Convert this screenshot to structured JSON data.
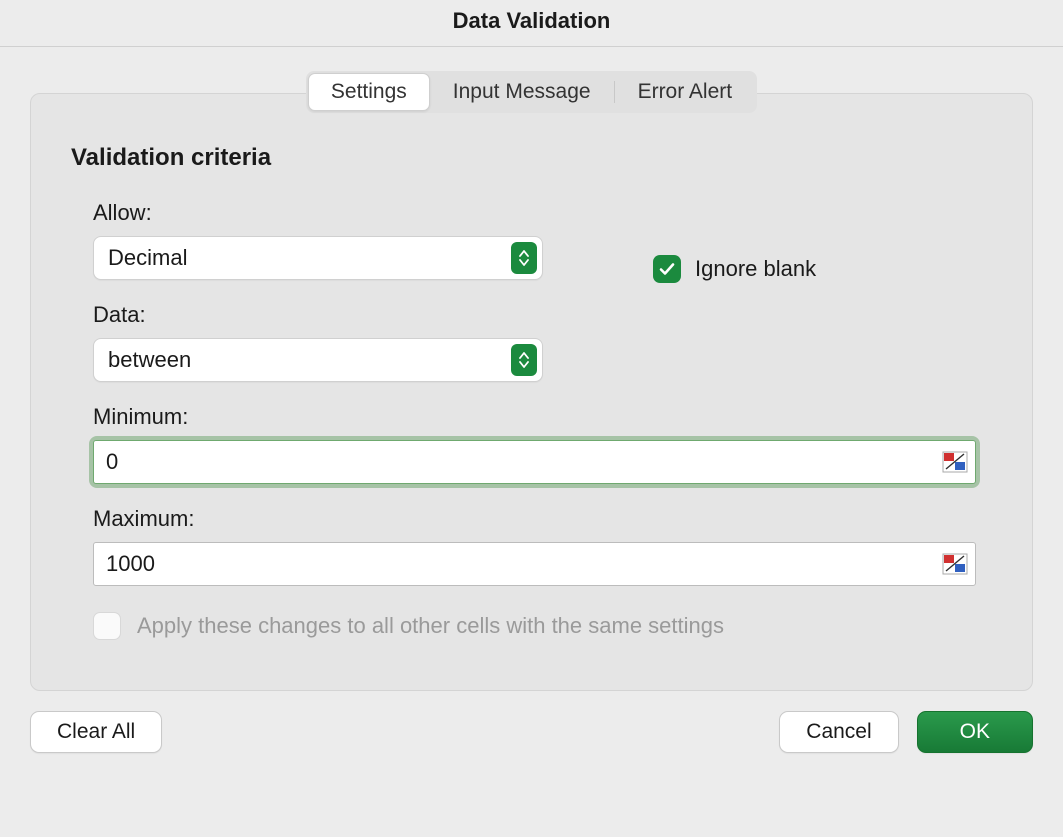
{
  "dialog": {
    "title": "Data Validation"
  },
  "tabs": {
    "settings": "Settings",
    "input_message": "Input Message",
    "error_alert": "Error Alert",
    "active": "settings"
  },
  "criteria": {
    "section_title": "Validation criteria",
    "allow_label": "Allow:",
    "allow_value": "Decimal",
    "data_label": "Data:",
    "data_value": "between",
    "minimum_label": "Minimum:",
    "minimum_value": "0",
    "maximum_label": "Maximum:",
    "maximum_value": "1000",
    "ignore_blank_label": "Ignore blank",
    "ignore_blank_checked": true,
    "apply_all_label": "Apply these changes to all other cells with the same settings",
    "apply_all_checked": false,
    "apply_all_enabled": false
  },
  "buttons": {
    "clear_all": "Clear All",
    "cancel": "Cancel",
    "ok": "OK"
  },
  "colors": {
    "accent": "#1b8a3e"
  }
}
